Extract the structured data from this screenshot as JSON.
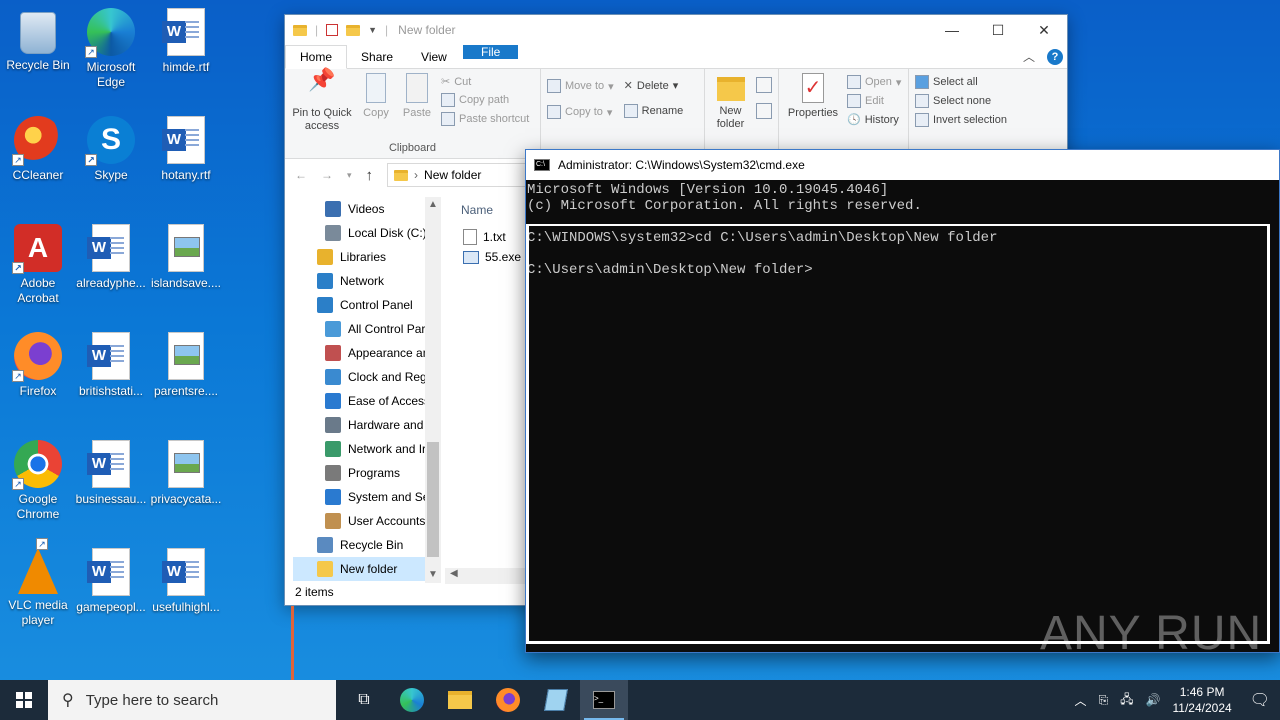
{
  "desktop": {
    "icons": [
      {
        "label": "Recycle Bin",
        "icon": "recycle-bin-icon"
      },
      {
        "label": "Microsoft Edge",
        "icon": "edge-icon"
      },
      {
        "label": "himde.rtf",
        "icon": "word-document-icon"
      },
      {
        "label": "CCleaner",
        "icon": "ccleaner-icon"
      },
      {
        "label": "Skype",
        "icon": "skype-icon"
      },
      {
        "label": "hotany.rtf",
        "icon": "word-document-icon"
      },
      {
        "label": "Adobe Acrobat",
        "icon": "acrobat-icon"
      },
      {
        "label": "alreadyphe...",
        "icon": "word-document-icon"
      },
      {
        "label": "islandsave....",
        "icon": "image-file-icon"
      },
      {
        "label": "Firefox",
        "icon": "firefox-icon"
      },
      {
        "label": "britishstati...",
        "icon": "word-document-icon"
      },
      {
        "label": "parentsre....",
        "icon": "image-file-icon"
      },
      {
        "label": "Google Chrome",
        "icon": "chrome-icon"
      },
      {
        "label": "businessau...",
        "icon": "word-document-icon"
      },
      {
        "label": "privacycata...",
        "icon": "image-file-icon"
      },
      {
        "label": "VLC media player",
        "icon": "vlc-icon"
      },
      {
        "label": "gamepeopl...",
        "icon": "word-document-icon"
      },
      {
        "label": "usefulhighl...",
        "icon": "word-document-icon"
      }
    ]
  },
  "explorer": {
    "title": "New folder",
    "tabs": {
      "file": "File",
      "home": "Home",
      "share": "Share",
      "view": "View"
    },
    "ribbon": {
      "pin": "Pin to Quick access",
      "copy": "Copy",
      "paste": "Paste",
      "cut": "Cut",
      "copy_path": "Copy path",
      "paste_shortcut": "Paste shortcut",
      "clipboard": "Clipboard",
      "move_to": "Move to",
      "copy_to": "Copy to",
      "delete": "Delete",
      "rename": "Rename",
      "new_folder": "New folder",
      "properties": "Properties",
      "open": "Open",
      "edit": "Edit",
      "history": "History",
      "select_all": "Select all",
      "select_none": "Select none",
      "invert_selection": "Invert selection"
    },
    "address": "New folder",
    "nav": [
      {
        "label": "Videos",
        "indent": 1
      },
      {
        "label": "Local Disk (C:)",
        "indent": 1
      },
      {
        "label": "Libraries",
        "indent": 0
      },
      {
        "label": "Network",
        "indent": 0
      },
      {
        "label": "Control Panel",
        "indent": 0
      },
      {
        "label": "All Control Par",
        "indent": 1
      },
      {
        "label": "Appearance an",
        "indent": 1
      },
      {
        "label": "Clock and Regi",
        "indent": 1
      },
      {
        "label": "Ease of Access",
        "indent": 1
      },
      {
        "label": "Hardware and",
        "indent": 1
      },
      {
        "label": "Network and Ir",
        "indent": 1
      },
      {
        "label": "Programs",
        "indent": 1
      },
      {
        "label": "System and Sec",
        "indent": 1
      },
      {
        "label": "User Accounts",
        "indent": 1
      },
      {
        "label": "Recycle Bin",
        "indent": 0
      },
      {
        "label": "New folder",
        "indent": 0
      }
    ],
    "column_name": "Name",
    "files": [
      "1.txt",
      "55.exe"
    ],
    "status": "2 items"
  },
  "cmd": {
    "title": "Administrator: C:\\Windows\\System32\\cmd.exe",
    "lines": [
      "Microsoft Windows [Version 10.0.19045.4046]",
      "(c) Microsoft Corporation. All rights reserved.",
      "",
      "C:\\WINDOWS\\system32>cd C:\\Users\\admin\\Desktop\\New folder",
      "",
      "C:\\Users\\admin\\Desktop\\New folder>"
    ]
  },
  "watermark": "ANY RUN",
  "taskbar": {
    "search_placeholder": "Type here to search",
    "time": "1:46 PM",
    "date": "11/24/2024"
  }
}
